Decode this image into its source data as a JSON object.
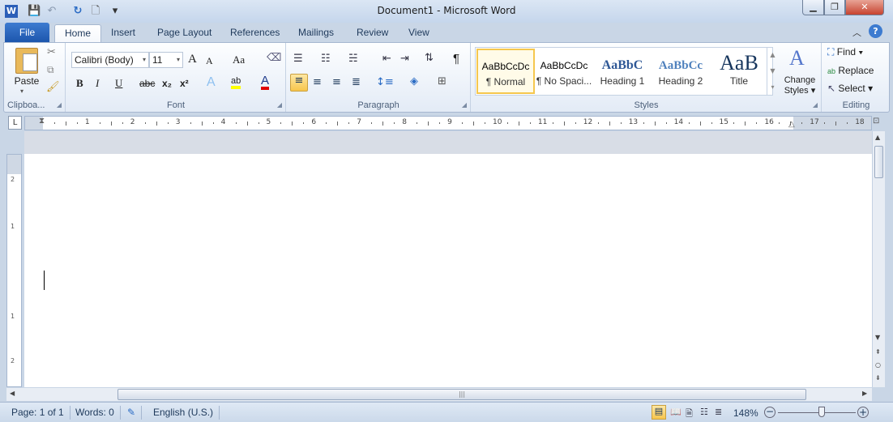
{
  "window": {
    "title": "Document1  -  Microsoft Word",
    "minimize": "▁",
    "restore": "❐",
    "close": "✕"
  },
  "qat": {
    "word_icon": "W",
    "save": "💾",
    "undo": "↶",
    "redo": "↻",
    "new": "🗋",
    "customize": "▾"
  },
  "tabs": {
    "file": "File",
    "items": [
      "Home",
      "Insert",
      "Page Layout",
      "References",
      "Mailings",
      "Review",
      "View"
    ],
    "active": "Home"
  },
  "clipboard": {
    "paste": "Paste",
    "label": "Clipboa..."
  },
  "font": {
    "name": "Calibri (Body)",
    "size": "11",
    "grow": "A",
    "shrink": "A",
    "case": "Aa",
    "bold": "B",
    "italic": "I",
    "underline": "U",
    "strike": "abc",
    "sub": "x₂",
    "sup": "x²",
    "effects": "A",
    "highlight": "ab",
    "color": "A",
    "label": "Font",
    "highlight_color": "#ffff00",
    "font_color": "#e00000"
  },
  "paragraph": {
    "pilcrow": "¶",
    "label": "Paragraph"
  },
  "styles": {
    "items": [
      {
        "preview": "AaBbCcDc",
        "name": "¶ Normal",
        "selected": true
      },
      {
        "preview": "AaBbCcDc",
        "name": "¶ No Spaci..."
      },
      {
        "preview": "AaBbC",
        "name": "Heading 1"
      },
      {
        "preview": "AaBbCc",
        "name": "Heading 2"
      },
      {
        "preview": "AaB",
        "name": "Title"
      }
    ],
    "change_line1": "Change",
    "change_line2": "Styles",
    "label": "Styles"
  },
  "editing": {
    "find": "Find",
    "replace": "Replace",
    "select": "Select",
    "label": "Editing"
  },
  "ruler": {
    "numbers": [
      "1",
      "2",
      "3",
      "4",
      "5",
      "6",
      "7",
      "8",
      "9",
      "10",
      "11",
      "12",
      "13",
      "14",
      "15",
      "16",
      "17",
      "18"
    ],
    "tab_selector": "L"
  },
  "status": {
    "page": "Page: 1 of 1",
    "words": "Words: 0",
    "language": "English (U.S.)",
    "zoom": "148%",
    "zoom_percent": 148
  },
  "colors": {
    "accent": "#2b5797",
    "file_tab": "#2a62b9",
    "selected_style": "#f5c74e"
  }
}
